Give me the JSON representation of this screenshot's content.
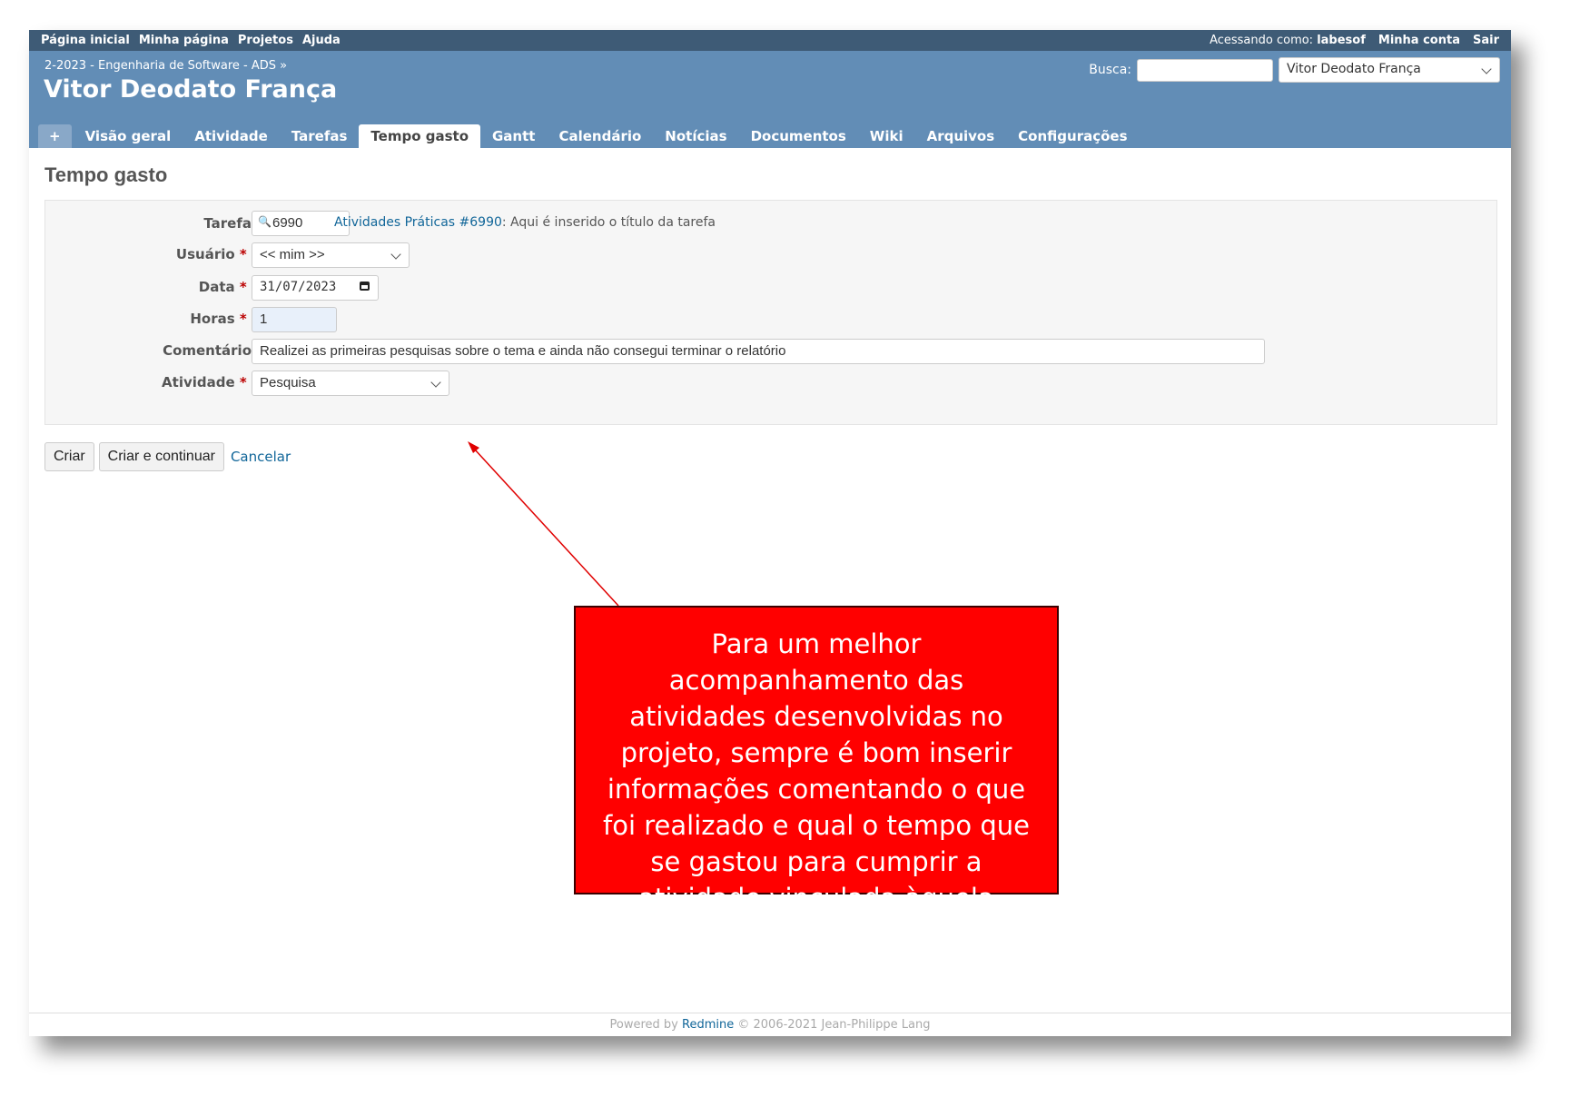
{
  "top_menu": {
    "home": "Página inicial",
    "my_page": "Minha página",
    "projects": "Projetos",
    "help": "Ajuda",
    "logged_as_label": "Acessando como:",
    "logged_as_user": "labesof",
    "my_account": "Minha conta",
    "logout": "Sair"
  },
  "header": {
    "breadcrumb": "2-2023 - Engenharia de Software - ADS »",
    "project_title": "Vitor Deodato França",
    "search_label": "Busca:",
    "search_value": "",
    "project_jump_value": "Vitor Deodato França"
  },
  "tabs": [
    {
      "label": "+"
    },
    {
      "label": "Visão geral"
    },
    {
      "label": "Atividade"
    },
    {
      "label": "Tarefas"
    },
    {
      "label": "Tempo gasto",
      "selected": true
    },
    {
      "label": "Gantt"
    },
    {
      "label": "Calendário"
    },
    {
      "label": "Notícias"
    },
    {
      "label": "Documentos"
    },
    {
      "label": "Wiki"
    },
    {
      "label": "Arquivos"
    },
    {
      "label": "Configurações"
    }
  ],
  "page": {
    "title": "Tempo gasto"
  },
  "form": {
    "issue_label": "Tarefa",
    "issue_value": "6990",
    "issue_link_text": "Atividades Práticas #6990",
    "issue_subject": ": Aqui é inserido o título da tarefa",
    "user_label": "Usuário",
    "user_value": "<< mim >>",
    "date_label": "Data",
    "date_value": "31/07/2023",
    "hours_label": "Horas",
    "hours_value": "1",
    "comment_label": "Comentário",
    "comment_value": "Realizei as primeiras pesquisas sobre o tema e ainda não consegui terminar o relatório",
    "activity_label": "Atividade",
    "activity_value": "Pesquisa",
    "required_mark": "*"
  },
  "buttons": {
    "create": "Criar",
    "create_continue": "Criar e continuar",
    "cancel": "Cancelar"
  },
  "footer": {
    "powered_by": "Powered by",
    "redmine": "Redmine",
    "copyright": "© 2006-2021 Jean-Philippe Lang"
  },
  "annotation": {
    "text": "Para um melhor acompanhamento das atividades desenvolvidas no projeto, sempre é bom inserir informações comentando o que foi realizado e qual o tempo que se gastou para cumprir a atividade vinculada àquela tarefa.",
    "box_color": "#ff0000",
    "arrow_color": "#e00000"
  },
  "colors": {
    "top_menu_bg": "#3e5b76",
    "header_bg": "#628db6",
    "link": "#116699"
  }
}
